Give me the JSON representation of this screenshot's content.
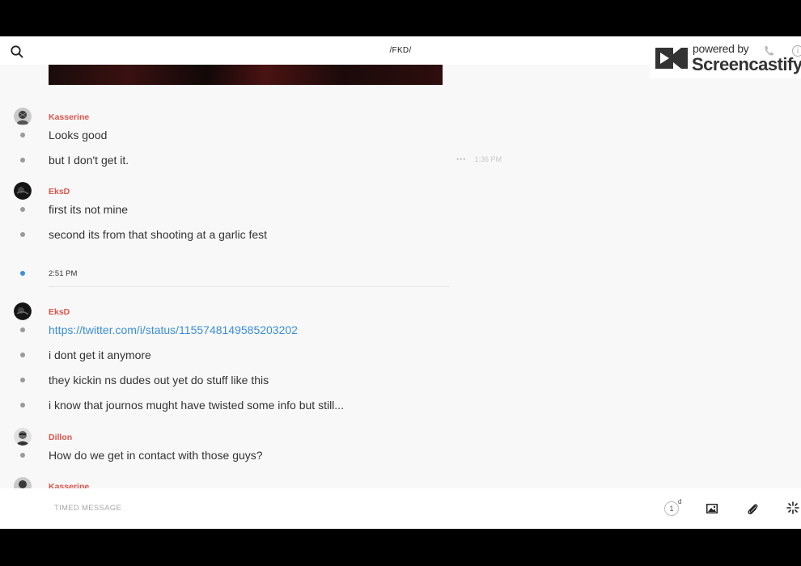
{
  "header": {
    "title": "/FKD/"
  },
  "watermark": {
    "powered": "powered by",
    "brand": "Screencastify",
    "info": "i"
  },
  "messages": [
    {
      "sender": "Kasserine",
      "lines": [
        "Looks good",
        "but I don't get it."
      ],
      "hover_meta": {
        "more": "•••",
        "time": "1:36 PM"
      }
    },
    {
      "sender": "EksD",
      "lines": [
        "first its not mine",
        "second its from that shooting at a garlic fest"
      ]
    },
    {
      "timestamp": "2:51 PM"
    },
    {
      "sender": "EksD",
      "lines": [
        "https://twitter.com/i/status/1155748149585203202",
        "i dont get it anymore",
        "they kickin ns dudes out yet do stuff like this",
        "i know that journos mught have twisted some info but still..."
      ]
    },
    {
      "sender": "Dillon",
      "lines": [
        "How do we get in contact with those guys?"
      ]
    },
    {
      "sender": "Kasserine",
      "lines": []
    }
  ],
  "composer": {
    "placeholder": "TIMED MESSAGE",
    "timer": {
      "value": "1",
      "unit": "d"
    }
  },
  "colors": {
    "sender": "#e0544a",
    "link": "#3a8fd8",
    "dot": "#9a9a9a",
    "unread_dot": "#3a8fd8"
  }
}
